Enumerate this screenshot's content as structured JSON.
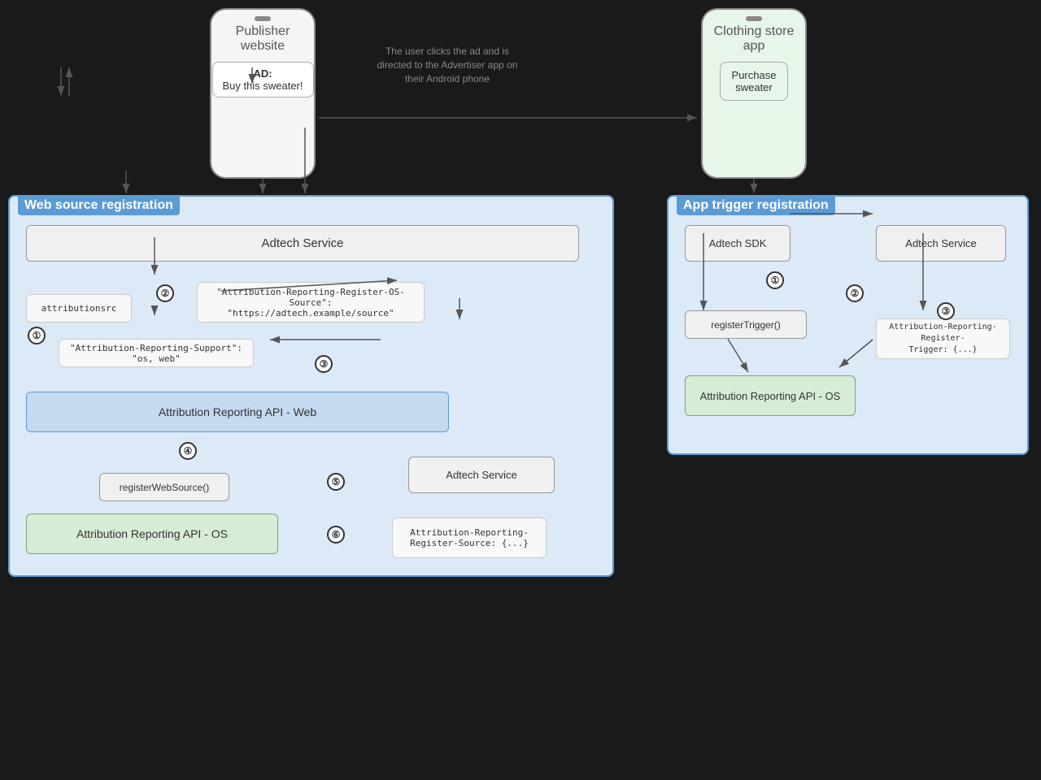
{
  "publisher_phone": {
    "title": "Publisher\nwebsite",
    "ad_label": "AD:",
    "ad_text": "Buy this\nsweater!"
  },
  "clothing_phone": {
    "title": "Clothing store\napp",
    "content": "Purchase\nsweater"
  },
  "description": "The user clicks the ad and is\ndirected to the Advertiser app on\ntheir Android phone",
  "web_section": {
    "title": "Web source registration",
    "adtech_service_top": "Adtech Service",
    "attributionsrc": "attributionsrc",
    "header_response": "\"Attribution-Reporting-Register-OS-Source\":\n\"https://adtech.example/source\"",
    "support_response": "\"Attribution-Reporting-Support\": \"os, web\"",
    "api_web": "Attribution Reporting API - Web",
    "register_web": "registerWebSource()",
    "adtech_service_bottom": "Adtech Service",
    "register_source": "Attribution-Reporting-\nRegister-Source: {...}",
    "api_os": "Attribution Reporting API - OS"
  },
  "app_section": {
    "title": "App trigger registration",
    "adtech_sdk": "Adtech SDK",
    "register_trigger": "registerTrigger()",
    "adtech_service": "Adtech Service",
    "api_os": "Attribution Reporting API - OS",
    "trigger_header": "Attribution-Reporting-Register-\nTrigger: {...}"
  },
  "steps": {
    "one": "①",
    "two": "②",
    "three": "③",
    "four": "④",
    "five": "⑤",
    "six": "⑥"
  }
}
